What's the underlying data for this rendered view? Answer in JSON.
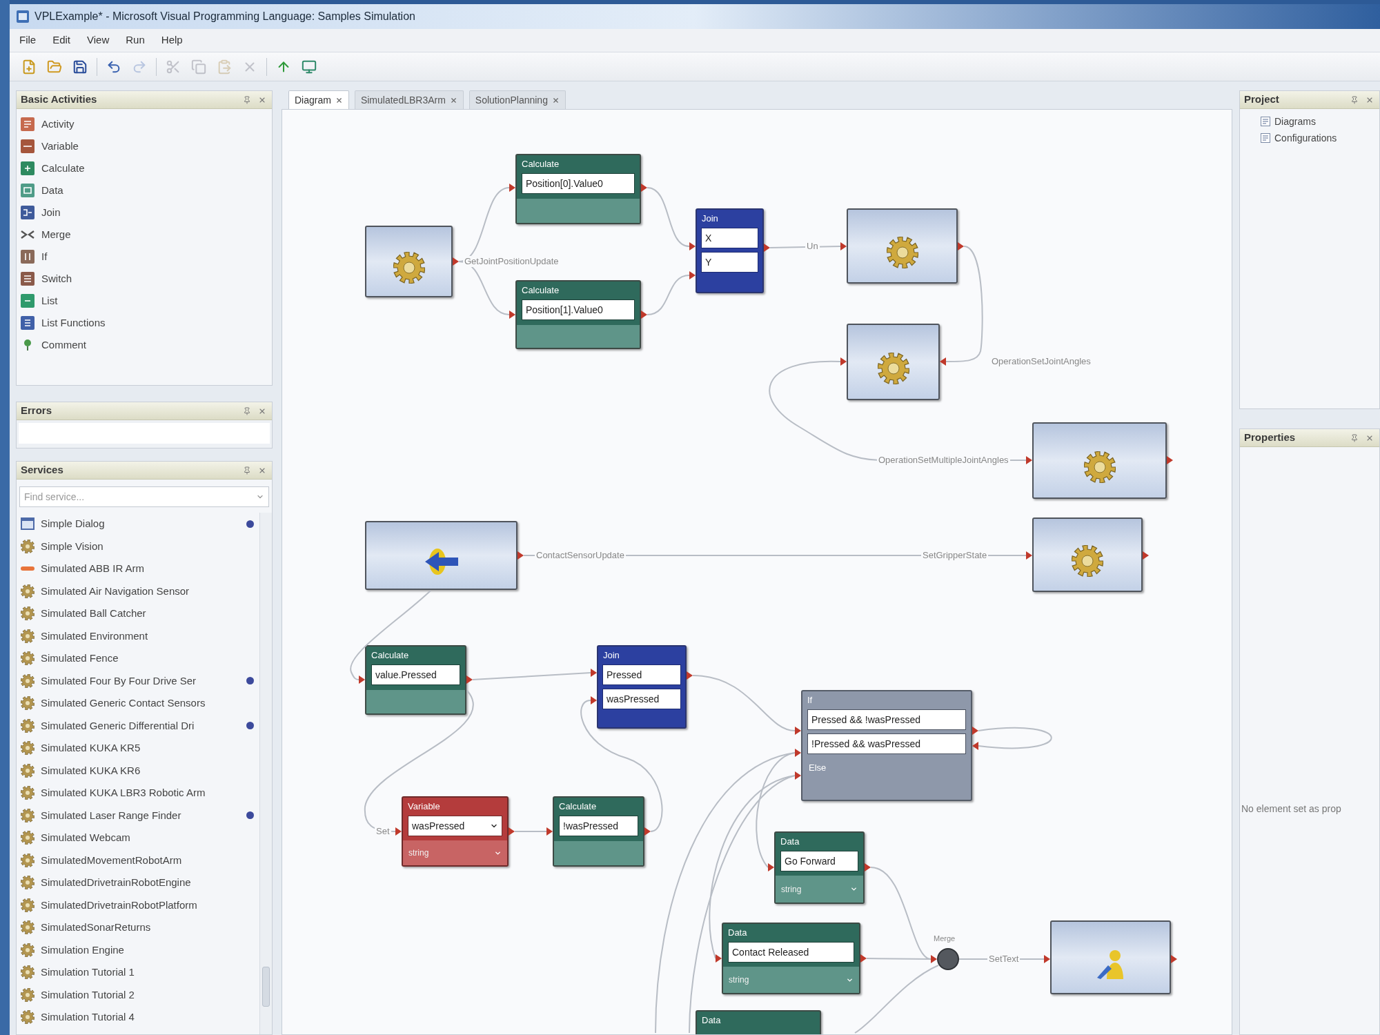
{
  "window": {
    "title": "VPLExample* - Microsoft Visual Programming Language: Samples Simulation"
  },
  "menu": [
    "File",
    "Edit",
    "View",
    "Run",
    "Help"
  ],
  "toolbar": [
    {
      "kind": "new",
      "disabled": false
    },
    {
      "kind": "open",
      "disabled": false
    },
    {
      "kind": "save",
      "disabled": false
    },
    {
      "kind": "undo",
      "disabled": false
    },
    {
      "kind": "redo",
      "disabled": true
    },
    {
      "kind": "cut",
      "disabled": true
    },
    {
      "kind": "copy",
      "disabled": true
    },
    {
      "kind": "paste",
      "disabled": true
    },
    {
      "kind": "delete",
      "disabled": true
    },
    {
      "kind": "run",
      "disabled": false
    },
    {
      "kind": "debug",
      "disabled": false
    }
  ],
  "basic_activities": {
    "title": "Basic Activities",
    "items": [
      {
        "kind": "activity",
        "label": "Activity"
      },
      {
        "kind": "variable",
        "label": "Variable"
      },
      {
        "kind": "calculate",
        "label": "Calculate"
      },
      {
        "kind": "data",
        "label": "Data"
      },
      {
        "kind": "join",
        "label": "Join"
      },
      {
        "kind": "merge",
        "label": "Merge"
      },
      {
        "kind": "if",
        "label": "If"
      },
      {
        "kind": "switch",
        "label": "Switch"
      },
      {
        "kind": "list",
        "label": "List"
      },
      {
        "kind": "list-functions",
        "label": "List Functions"
      },
      {
        "kind": "comment",
        "label": "Comment"
      }
    ]
  },
  "errors": {
    "title": "Errors"
  },
  "services": {
    "title": "Services",
    "search": {
      "placeholder": "Find service..."
    },
    "items": [
      {
        "kind": "dialog",
        "label": "Simple Dialog",
        "indicator": true
      },
      {
        "kind": "service",
        "label": "Simple Vision",
        "indicator": false
      },
      {
        "kind": "line",
        "label": "Simulated ABB IR Arm",
        "indicator": false
      },
      {
        "kind": "service",
        "label": "Simulated Air Navigation Sensor",
        "indicator": false
      },
      {
        "kind": "service",
        "label": "Simulated Ball Catcher",
        "indicator": false
      },
      {
        "kind": "service",
        "label": "Simulated Environment",
        "indicator": false
      },
      {
        "kind": "service",
        "label": "Simulated Fence",
        "indicator": false
      },
      {
        "kind": "service",
        "label": "Simulated Four By Four Drive Ser",
        "indicator": true
      },
      {
        "kind": "service",
        "label": "Simulated Generic Contact Sensors",
        "indicator": false
      },
      {
        "kind": "service",
        "label": "Simulated Generic Differential Dri",
        "indicator": true
      },
      {
        "kind": "service",
        "label": "Simulated KUKA KR5",
        "indicator": false
      },
      {
        "kind": "service",
        "label": "Simulated KUKA KR6",
        "indicator": false
      },
      {
        "kind": "service",
        "label": "Simulated KUKA LBR3 Robotic Arm",
        "indicator": false
      },
      {
        "kind": "service",
        "label": "Simulated Laser Range Finder",
        "indicator": true
      },
      {
        "kind": "service",
        "label": "Simulated Webcam",
        "indicator": false
      },
      {
        "kind": "service",
        "label": "SimulatedMovementRobotArm",
        "indicator": false
      },
      {
        "kind": "service",
        "label": "SimulatedDrivetrainRobotEngine",
        "indicator": false
      },
      {
        "kind": "service",
        "label": "SimulatedDrivetrainRobotPlatform",
        "indicator": false
      },
      {
        "kind": "service",
        "label": "SimulatedSonarReturns",
        "indicator": false
      },
      {
        "kind": "service",
        "label": "Simulation Engine",
        "indicator": false
      },
      {
        "kind": "service",
        "label": "Simulation Tutorial 1",
        "indicator": false
      },
      {
        "kind": "service",
        "label": "Simulation Tutorial 2",
        "indicator": false
      },
      {
        "kind": "service",
        "label": "Simulation Tutorial 4",
        "indicator": false
      }
    ]
  },
  "diagram": {
    "tabs": [
      {
        "label": "Diagram",
        "selected": true
      },
      {
        "label": "SimulatedLBR3Arm",
        "selected": false
      },
      {
        "label": "SolutionPlanning",
        "selected": false
      }
    ],
    "nodes": [
      {
        "kind": "service",
        "output_label": "GetJointPositionUpdate"
      },
      {
        "kind": "calculate",
        "title": "Calculate",
        "value": "Position[0].Value0"
      },
      {
        "kind": "calculate",
        "title": "Calculate",
        "value": "Position[1].Value0"
      },
      {
        "kind": "join",
        "title": "Join",
        "inputs": [
          "X",
          "Y"
        ]
      },
      {
        "kind": "service",
        "input_label": "Un"
      },
      {
        "kind": "service",
        "input_label": "OperationSetJointAngles"
      },
      {
        "kind": "service",
        "input_label": "OperationSetMultipleJointAngles"
      },
      {
        "kind": "service",
        "output_label": "ContactSensorUpdate"
      },
      {
        "kind": "service",
        "input_label": "SetGripperState"
      },
      {
        "kind": "calculate",
        "title": "Calculate",
        "value": "value.Pressed"
      },
      {
        "kind": "join",
        "title": "Join",
        "inputs": [
          "Pressed",
          "wasPressed"
        ]
      },
      {
        "kind": "if",
        "title": "If",
        "conditions": [
          "Pressed && !wasPressed",
          "!Pressed && wasPressed"
        ],
        "else": "Else"
      },
      {
        "kind": "variable",
        "title": "Variable",
        "value": "wasPressed",
        "type": "string",
        "input_label": "Set"
      },
      {
        "kind": "calculate",
        "title": "Calculate",
        "value": "!wasPressed"
      },
      {
        "kind": "data",
        "title": "Data",
        "value": "Go Forward",
        "type": "string"
      },
      {
        "kind": "data",
        "title": "Data",
        "value": "Contact Released",
        "type": "string"
      },
      {
        "kind": "merge",
        "title": "Merge"
      },
      {
        "kind": "service",
        "input_label": "SetText"
      },
      {
        "kind": "data",
        "title": "Data"
      }
    ]
  },
  "project": {
    "title": "Project",
    "items": [
      "Diagrams",
      "Configurations"
    ]
  },
  "properties": {
    "title": "Properties",
    "message": "No element set as prop"
  }
}
